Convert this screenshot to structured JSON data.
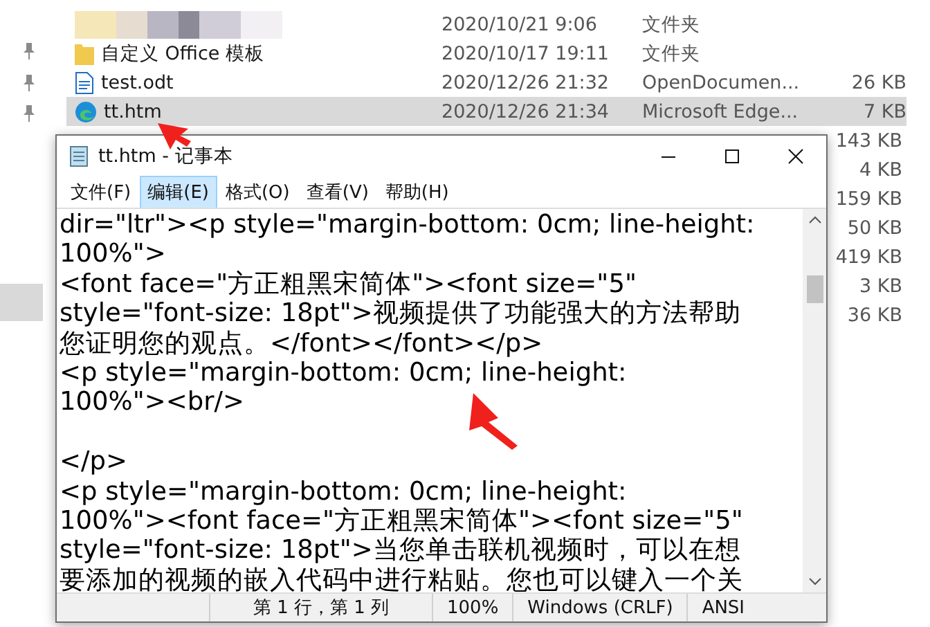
{
  "explorer": {
    "rows": [
      {
        "kind": "blurred",
        "date": "2020/10/21 9:06",
        "type": "文件夹",
        "selected": false
      },
      {
        "kind": "folder",
        "name": "自定义 Office 模板",
        "date": "2020/10/17 19:11",
        "type": "文件夹",
        "selected": false
      },
      {
        "kind": "document",
        "name": "test.odt",
        "date": "2020/12/26 21:32",
        "type": "OpenDocumen...",
        "size": "26 KB",
        "selected": false
      },
      {
        "kind": "browser",
        "name": "tt.htm",
        "date": "2020/12/26 21:34",
        "type": "Microsoft Edge...",
        "size": "7 KB",
        "selected": true
      },
      {
        "kind": "covered",
        "size": "143 KB",
        "selected": false
      },
      {
        "kind": "covered",
        "size": "4 KB",
        "selected": false
      },
      {
        "kind": "covered",
        "size": "159 KB",
        "selected": false
      },
      {
        "kind": "covered",
        "size": "50 KB",
        "selected": false
      },
      {
        "kind": "covered",
        "size": "419 KB",
        "selected": false
      },
      {
        "kind": "covered",
        "size": "3 KB",
        "selected": false
      },
      {
        "kind": "covered",
        "size": "36 KB",
        "selected": false
      }
    ]
  },
  "notepad": {
    "title": "tt.htm - 记事本",
    "menu": [
      {
        "label": "文件(F)",
        "selected": false
      },
      {
        "label": "编辑(E)",
        "selected": true
      },
      {
        "label": "格式(O)",
        "selected": false
      },
      {
        "label": "查看(V)",
        "selected": false
      },
      {
        "label": "帮助(H)",
        "selected": false
      }
    ],
    "lines": [
      {
        "kind": "text",
        "text": "dir=\"ltr\"><p style=\"margin-bottom: 0cm; line-height:"
      },
      {
        "kind": "text",
        "text": "100%\">"
      },
      {
        "kind": "text",
        "text": "<font face=\"方正粗黑宋简体\"><font size=\"5\""
      },
      {
        "kind": "text",
        "text": "style=\"font-size: 18pt\">视频提供了功能强大的方法帮助"
      },
      {
        "kind": "text",
        "text": "您证明您的观点。</font></font></p>"
      },
      {
        "kind": "text",
        "text": "<p style=\"margin-bottom: 0cm; line-height:"
      },
      {
        "kind": "text",
        "text": "100%\"><br/>"
      },
      {
        "kind": "blank"
      },
      {
        "kind": "text",
        "text": "</p>"
      },
      {
        "kind": "text",
        "text": "<p style=\"margin-bottom: 0cm; line-height:"
      },
      {
        "kind": "text",
        "text": "100%\"><font face=\"方正粗黑宋简体\"><font size=\"5\""
      },
      {
        "kind": "text",
        "text": "style=\"font-size: 18pt\">当您单击联机视频时，可以在想"
      },
      {
        "kind": "text",
        "text": "要添加的视频的嵌入代码中进行粘贴。您也可以键入一个关"
      }
    ],
    "status": [
      "第 1 行，第 1 列",
      "100%",
      "Windows (CRLF)",
      "ANSI"
    ]
  }
}
